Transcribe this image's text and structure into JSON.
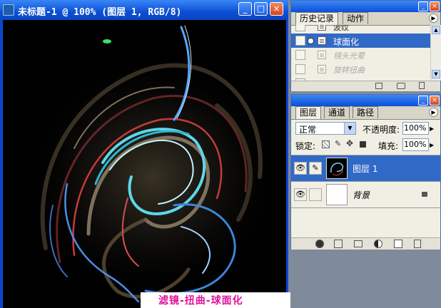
{
  "doc_window": {
    "title": "未标题-1 @ 100% (图层 1, RGB/8)",
    "buttons": {
      "minimize": "_",
      "maximize": "□",
      "close": "×"
    }
  },
  "caption": "滤镜-扭曲-球面化",
  "history_panel": {
    "tabs": [
      "历史记录",
      "动作"
    ],
    "items": [
      {
        "label": "波纹",
        "state": "normal"
      },
      {
        "label": "球面化",
        "state": "selected"
      },
      {
        "label": "镜头光晕",
        "state": "dim"
      },
      {
        "label": "旋转扭曲",
        "state": "dim"
      },
      {
        "label": "",
        "state": "dim"
      }
    ]
  },
  "layers_panel": {
    "tabs": [
      "图层",
      "通道",
      "路径"
    ],
    "blend_mode": "正常",
    "opacity_label": "不透明度:",
    "opacity_value": "100%",
    "lock_label": "锁定:",
    "fill_label": "填充:",
    "fill_value": "100%",
    "layers": [
      {
        "name": "图层 1",
        "selected": true
      },
      {
        "name": "背景",
        "selected": false,
        "italic": true
      }
    ]
  },
  "colors": {
    "selection": "#3169c6",
    "panel_bg": "#f1efe4",
    "canvas_bg": "#000000",
    "caption_text": "#e0119a"
  }
}
